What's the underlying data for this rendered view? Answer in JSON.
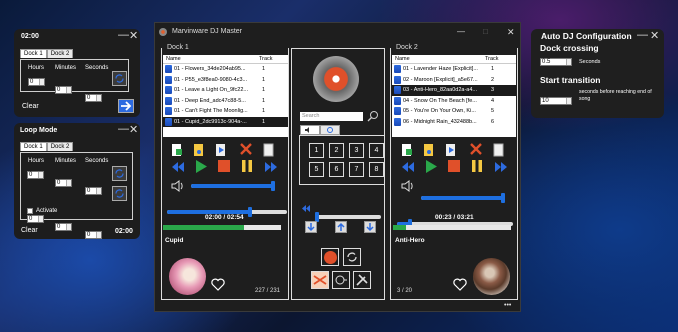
{
  "timer_window": {
    "title": "02:00",
    "tabs": [
      "Dock 1",
      "Dock 2"
    ],
    "fields": {
      "hours": "Hours",
      "minutes": "Minutes",
      "seconds": "Seconds"
    },
    "values": {
      "hours": "0",
      "minutes": "0",
      "seconds": "0"
    },
    "clear_label": "Clear"
  },
  "loop_window": {
    "title": "Loop Mode",
    "tabs": [
      "Dock 1",
      "Dock 2"
    ],
    "fields": {
      "hours": "Hours",
      "minutes": "Minutes",
      "seconds": "Seconds"
    },
    "row1": {
      "hours": "0",
      "minutes": "0",
      "seconds": "0"
    },
    "row2": {
      "hours": "0",
      "minutes": "0",
      "seconds": "0"
    },
    "activate_label": "Activate",
    "clear_label": "Clear",
    "time": "02:00"
  },
  "main_window": {
    "title": "Marvinware DJ Master",
    "dock1": {
      "label": "Dock 1",
      "columns": [
        "Name",
        "Track"
      ],
      "tracks": [
        {
          "name": "01 - Flowers_34de204ab95...",
          "track": "1"
        },
        {
          "name": "01 - P55_e3f8ea0-9080-4c3...",
          "track": "1"
        },
        {
          "name": "01 - Leave a Light On_9fc22...",
          "track": "1"
        },
        {
          "name": "01 - Deep End_adc47c88-5...",
          "track": "1"
        },
        {
          "name": "01 - Can't Fight The Moonlig...",
          "track": "1"
        },
        {
          "name": "01 - Cupid_2dc9913c-904a-...",
          "track": "1"
        }
      ],
      "selected_index": 5,
      "time": "02:00 / 02:54",
      "progress": 0.69,
      "volume": 1.0,
      "seek": 0.69,
      "title": "Cupid",
      "counter": "227 / 231"
    },
    "center": {
      "search_placeholder": "Search",
      "pads": [
        "1",
        "2",
        "3",
        "4",
        "5",
        "6",
        "7",
        "8"
      ],
      "crossfade": 0.0
    },
    "dock2": {
      "label": "Dock 2",
      "columns": [
        "Name",
        "Track"
      ],
      "tracks": [
        {
          "name": "01 - Lavender Haze [Explicit]...",
          "track": "1"
        },
        {
          "name": "02 - Maroon [Explicit]_a5e67...",
          "track": "2"
        },
        {
          "name": "03 - Anti-Hero_82aa0d2a-a4...",
          "track": "3"
        },
        {
          "name": "04 - Snow On The Beach [fe...",
          "track": "4"
        },
        {
          "name": "05 - You're On Your Own, Ki...",
          "track": "5"
        },
        {
          "name": "06 - Midnight Rain_432488b...",
          "track": "6"
        }
      ],
      "selected_index": 2,
      "time": "00:23 / 03:21",
      "progress": 0.11,
      "volume": 1.0,
      "seek": 0.11,
      "title": "Anti-Hero",
      "counter": "3 / 20"
    },
    "more_label": "•••"
  },
  "autodj_window": {
    "title": "Auto DJ Configuration",
    "crossing_heading": "Dock crossing",
    "crossing_value": "0.5",
    "crossing_unit": "Seconds",
    "transition_heading": "Start transition",
    "transition_value": "10",
    "transition_unit": "seconds before reaching end of song"
  },
  "colors": {
    "accent": "#1e6fe0",
    "green": "#2aa84a",
    "red": "#e0502a",
    "window": "#1d1d1d"
  }
}
